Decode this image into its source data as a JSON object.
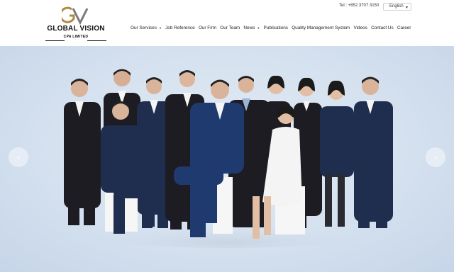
{
  "header": {
    "logo": {
      "brand": "GLOBAL VISION",
      "subtitle": "CPA LIMITED",
      "mark": "GV"
    },
    "phone": "Tel : +852 3707 3150",
    "language": {
      "selected": "English"
    },
    "nav": [
      {
        "label": "Our Services",
        "has_dropdown": true
      },
      {
        "label": "Job Reference",
        "has_dropdown": false
      },
      {
        "label": "Our Firm",
        "has_dropdown": false
      },
      {
        "label": "Our Team",
        "has_dropdown": false
      },
      {
        "label": "News",
        "has_dropdown": true
      },
      {
        "label": "Publications",
        "has_dropdown": false
      },
      {
        "label": "Quality Management System",
        "has_dropdown": false
      },
      {
        "label": "Videos",
        "has_dropdown": false
      },
      {
        "label": "Contact Us",
        "has_dropdown": false
      },
      {
        "label": "Career",
        "has_dropdown": false
      }
    ],
    "caret_glyph": "▼"
  },
  "hero": {
    "slider_prev_glyph": "‹",
    "slider_next_glyph": "›"
  },
  "colors": {
    "accent_gold": "#b08a3e",
    "logo_gray": "#7a7a7a",
    "hero_bg": "#d5e1ef",
    "suit_navy": "#1f2d4f",
    "suit_black": "#1c1c22"
  }
}
